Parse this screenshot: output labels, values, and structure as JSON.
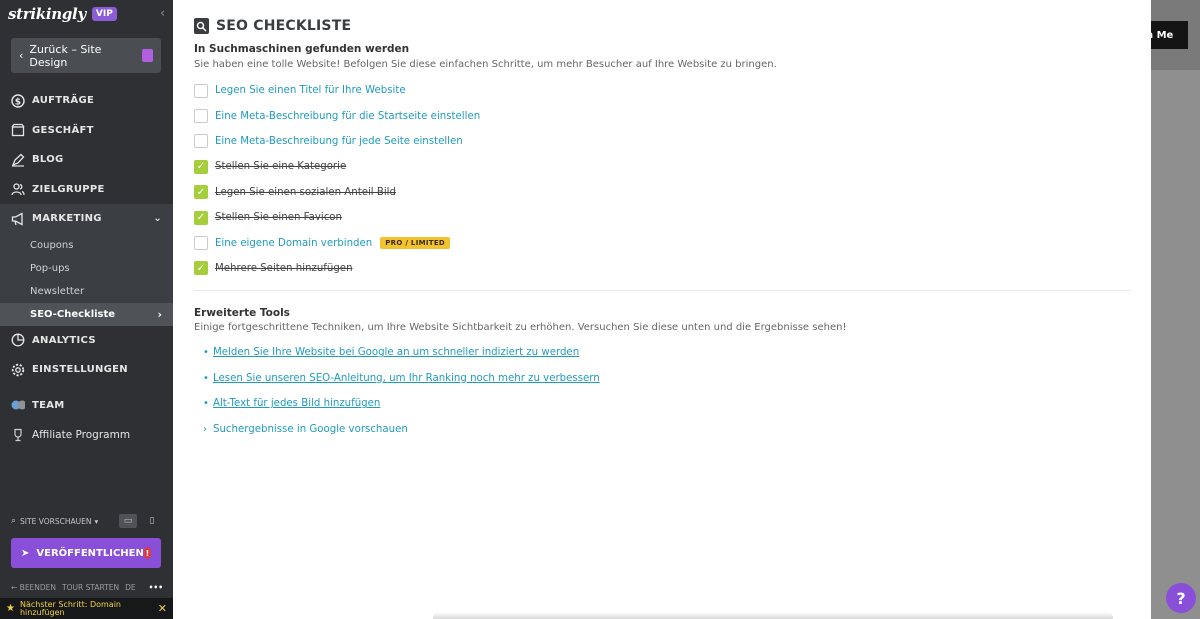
{
  "sidebar": {
    "logo": "strikingly",
    "vip": "VIP",
    "back_label": "Zurück – Site Design",
    "nav": [
      {
        "label": "AUFTRÄGE",
        "icon": "dollar-icon"
      },
      {
        "label": "GESCHÄFT",
        "icon": "store-icon"
      },
      {
        "label": "BLOG",
        "icon": "pen-icon"
      },
      {
        "label": "ZIELGRUPPE",
        "icon": "users-icon"
      },
      {
        "label": "MARKETING",
        "icon": "megaphone-icon"
      }
    ],
    "marketing_sub": [
      "Coupons",
      "Pop-ups",
      "Newsletter",
      "SEO-Checkliste"
    ],
    "nav2": [
      {
        "label": "ANALYTICS",
        "icon": "pie-icon"
      },
      {
        "label": "EINSTELLUNGEN",
        "icon": "gear-icon"
      },
      {
        "label": "TEAM",
        "icon": "team-icon"
      },
      {
        "label": "Affiliate Programm",
        "icon": "trophy-icon"
      }
    ],
    "preview_label": "SITE VORSCHAUEN",
    "publish_label": "VERÖFFENTLICHEN",
    "footer": {
      "quit": "← BEENDEN",
      "tour": "TOUR STARTEN",
      "lang": "DE"
    },
    "next_step": "Nächster Schritt: Domain hinzufügen"
  },
  "background": {
    "button_label": "h Me"
  },
  "modal": {
    "title": "SEO CHECKLISTE",
    "section1_title": "In Suchmaschinen gefunden werden",
    "section1_desc": "Sie haben eine tolle Website! Befolgen Sie diese einfachen Schritte, um mehr Besucher auf Ihre Website zu bringen.",
    "checklist": [
      {
        "label": "Legen Sie einen Titel für Ihre Website",
        "done": false
      },
      {
        "label": "Eine Meta-Beschreibung für die Startseite einstellen",
        "done": false
      },
      {
        "label": "Eine Meta-Beschreibung für jede Seite einstellen",
        "done": false
      },
      {
        "label": "Stellen Sie eine Kategorie",
        "done": true
      },
      {
        "label": "Legen Sie einen sozialen Anteil Bild",
        "done": true
      },
      {
        "label": "Stellen Sie einen Favicon",
        "done": true
      },
      {
        "label": "Eine eigene Domain verbinden",
        "done": false,
        "badge": "PRO / LIMITED"
      },
      {
        "label": "Mehrere Seiten hinzufügen",
        "done": true
      }
    ],
    "section2_title": "Erweiterte Tools",
    "section2_desc": "Einige fortgeschrittene Techniken, um Ihre Website Sichtbarkeit zu erhöhen. Versuchen Sie diese unten und die Ergebnisse sehen!",
    "tools": [
      "Melden Sie Ihre Website bei Google an um schneller indiziert zu werden",
      "Lesen Sie unseren SEO-Anleitung, um Ihr Ranking noch mehr zu verbessern",
      "Alt-Text für jedes Bild hinzufügen"
    ],
    "preview_toggle": "Suchergebnisse in Google vorschauen"
  },
  "colors": {
    "accent": "#8a4fd8",
    "link": "#1f9bbf",
    "check": "#a6cd3c",
    "sidebar": "#2e3033"
  }
}
